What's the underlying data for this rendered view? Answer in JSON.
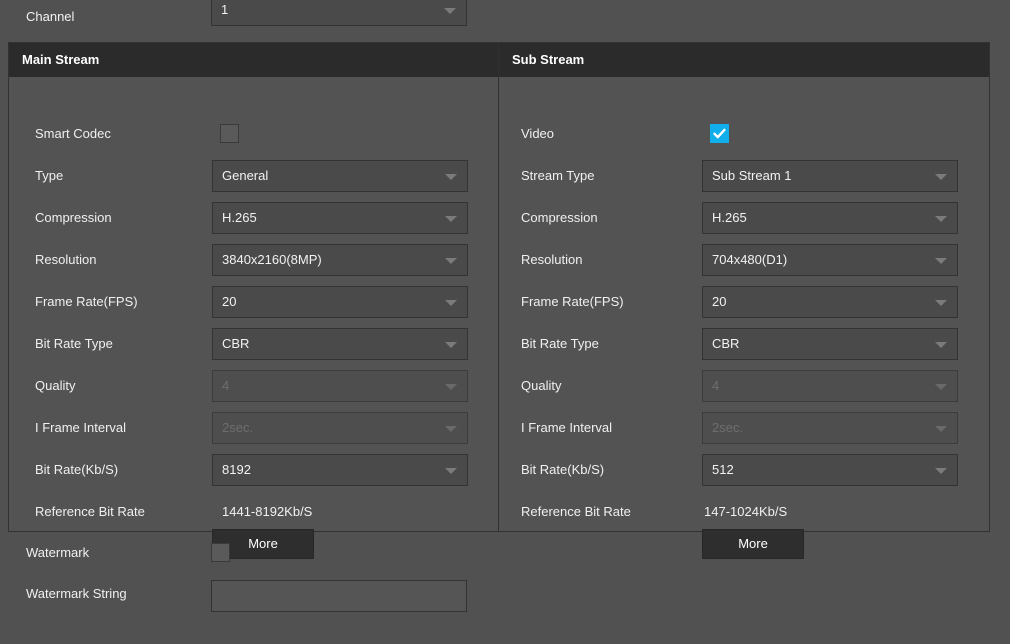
{
  "colors": {
    "page_bg": "#515151",
    "panel_bg": "#535353",
    "header_bg": "#2b2b2b",
    "field_bg": "#4a4a4a",
    "accent_checkbox": "#10aeea",
    "text": "#f0f0f0",
    "disabled_text": "#6e6e6e"
  },
  "channel": {
    "label": "Channel",
    "value": "1"
  },
  "main_stream": {
    "title": "Main Stream",
    "rows": [
      {
        "label": "Smart Codec",
        "type": "checkbox",
        "checked": false
      },
      {
        "label": "Type",
        "type": "dropdown",
        "value": "General",
        "disabled": false
      },
      {
        "label": "Compression",
        "type": "dropdown",
        "value": "H.265",
        "disabled": false
      },
      {
        "label": "Resolution",
        "type": "dropdown",
        "value": "3840x2160(8MP)",
        "disabled": false
      },
      {
        "label": "Frame Rate(FPS)",
        "type": "dropdown",
        "value": "20",
        "disabled": false
      },
      {
        "label": "Bit Rate Type",
        "type": "dropdown",
        "value": "CBR",
        "disabled": false
      },
      {
        "label": "Quality",
        "type": "dropdown",
        "value": "4",
        "disabled": true
      },
      {
        "label": "I Frame Interval",
        "type": "dropdown",
        "value": "2sec.",
        "disabled": true
      },
      {
        "label": "Bit Rate(Kb/S)",
        "type": "dropdown",
        "value": "8192",
        "disabled": false
      },
      {
        "label": "Reference Bit Rate",
        "type": "static",
        "value": "1441-8192Kb/S"
      }
    ],
    "more_button": "More"
  },
  "sub_stream": {
    "title": "Sub Stream",
    "rows": [
      {
        "label": "Video",
        "type": "checkbox",
        "checked": true
      },
      {
        "label": "Stream Type",
        "type": "dropdown",
        "value": "Sub Stream 1",
        "disabled": false
      },
      {
        "label": "Compression",
        "type": "dropdown",
        "value": "H.265",
        "disabled": false
      },
      {
        "label": "Resolution",
        "type": "dropdown",
        "value": "704x480(D1)",
        "disabled": false
      },
      {
        "label": "Frame Rate(FPS)",
        "type": "dropdown",
        "value": "20",
        "disabled": false
      },
      {
        "label": "Bit Rate Type",
        "type": "dropdown",
        "value": "CBR",
        "disabled": false
      },
      {
        "label": "Quality",
        "type": "dropdown",
        "value": "4",
        "disabled": true
      },
      {
        "label": "I Frame Interval",
        "type": "dropdown",
        "value": "2sec.",
        "disabled": true
      },
      {
        "label": "Bit Rate(Kb/S)",
        "type": "dropdown",
        "value": "512",
        "disabled": false
      },
      {
        "label": "Reference Bit Rate",
        "type": "static",
        "value": "147-1024Kb/S"
      }
    ],
    "more_button": "More"
  },
  "watermark": {
    "label": "Watermark",
    "checked": false,
    "string_label": "Watermark String",
    "string_value": "",
    "string_placeholder": ""
  },
  "icons": {
    "dropdown_arrow": "chevron-down-icon",
    "check": "check-icon"
  }
}
